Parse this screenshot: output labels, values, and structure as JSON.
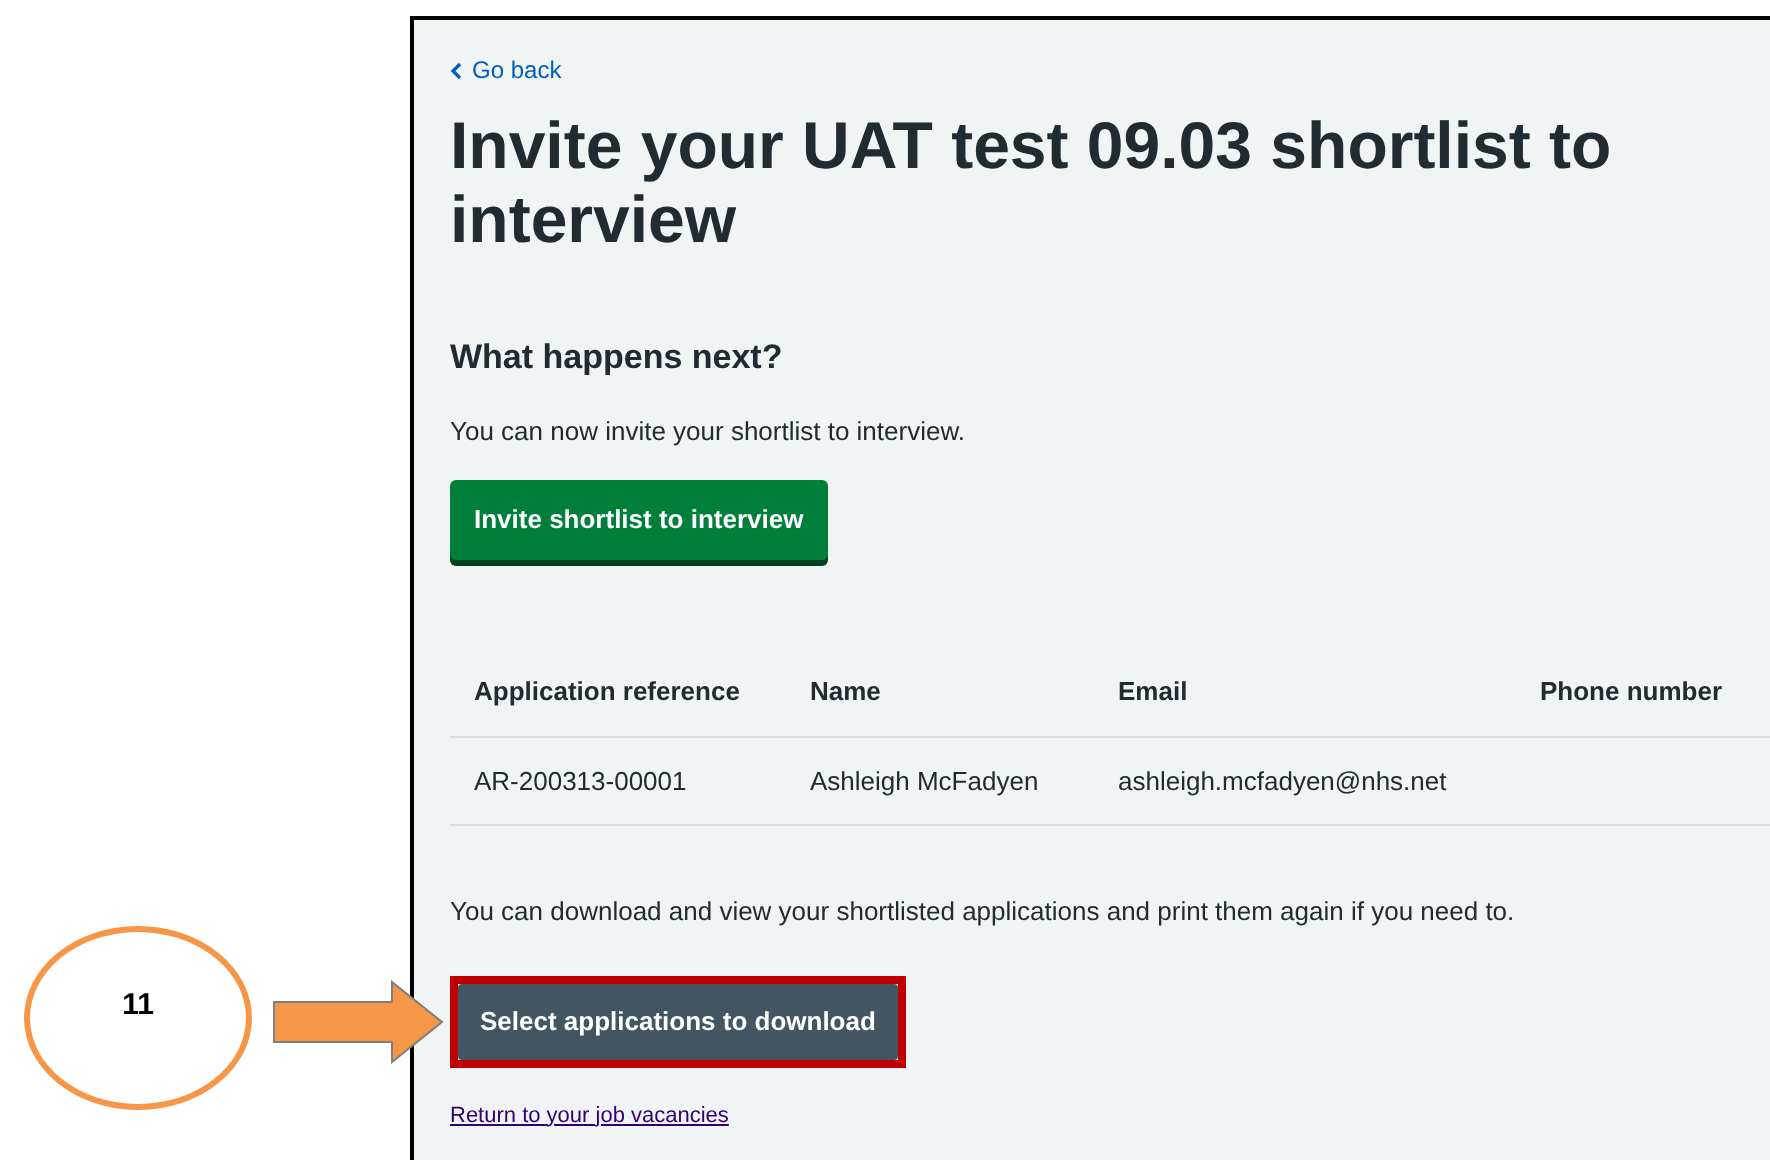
{
  "back_link": "Go back",
  "title": "Invite your UAT test 09.03 shortlist to interview",
  "section_heading": "What happens next?",
  "intro": "You can now invite your shortlist to interview.",
  "invite_button": "Invite shortlist to interview",
  "table": {
    "columns": [
      "Application reference",
      "Name",
      "Email",
      "Phone number"
    ],
    "rows": [
      [
        "AR-200313-00001",
        "Ashleigh McFadyen",
        "ashleigh.mcfadyen@nhs.net"
      ]
    ]
  },
  "download_text": "You can download and view your shortlisted applications and print them again if you need to.",
  "download_button": {
    "label": "Select applications to download",
    "highlighted": true
  },
  "return_link": "Return to your job vacancies",
  "callout": {
    "number": "11"
  }
}
